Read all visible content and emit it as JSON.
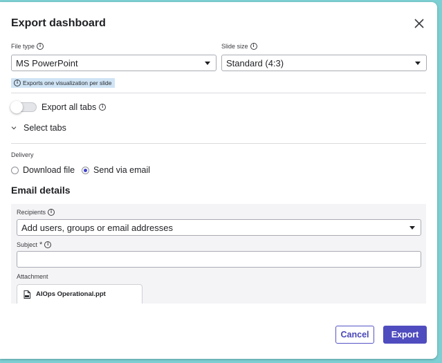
{
  "dialog": {
    "title": "Export dashboard",
    "close_icon": "close-icon"
  },
  "file_type": {
    "label": "File type",
    "value": "MS PowerPoint",
    "note": "Exports one visualization per slide"
  },
  "slide_size": {
    "label": "Slide size",
    "value": "Standard (4:3)"
  },
  "export_all_tabs": {
    "label": "Export all tabs",
    "enabled": false
  },
  "select_tabs": {
    "label": "Select tabs",
    "expanded": false
  },
  "delivery": {
    "label": "Delivery",
    "options": [
      {
        "label": "Download file",
        "selected": false
      },
      {
        "label": "Send via email",
        "selected": true
      }
    ]
  },
  "email_details": {
    "title": "Email details",
    "recipients": {
      "label": "Recipients",
      "placeholder": "Add users, groups or email addresses"
    },
    "subject": {
      "label": "Subject",
      "required_marker": "*",
      "value": ""
    },
    "attachment": {
      "label": "Attachment",
      "file_name": "AIOps Operational.ppt"
    }
  },
  "footer": {
    "cancel_label": "Cancel",
    "export_label": "Export"
  },
  "colors": {
    "primary": "#4f4cbf",
    "info_note_bg": "#cfe4f5",
    "panel_bg": "#f4f4f6"
  }
}
